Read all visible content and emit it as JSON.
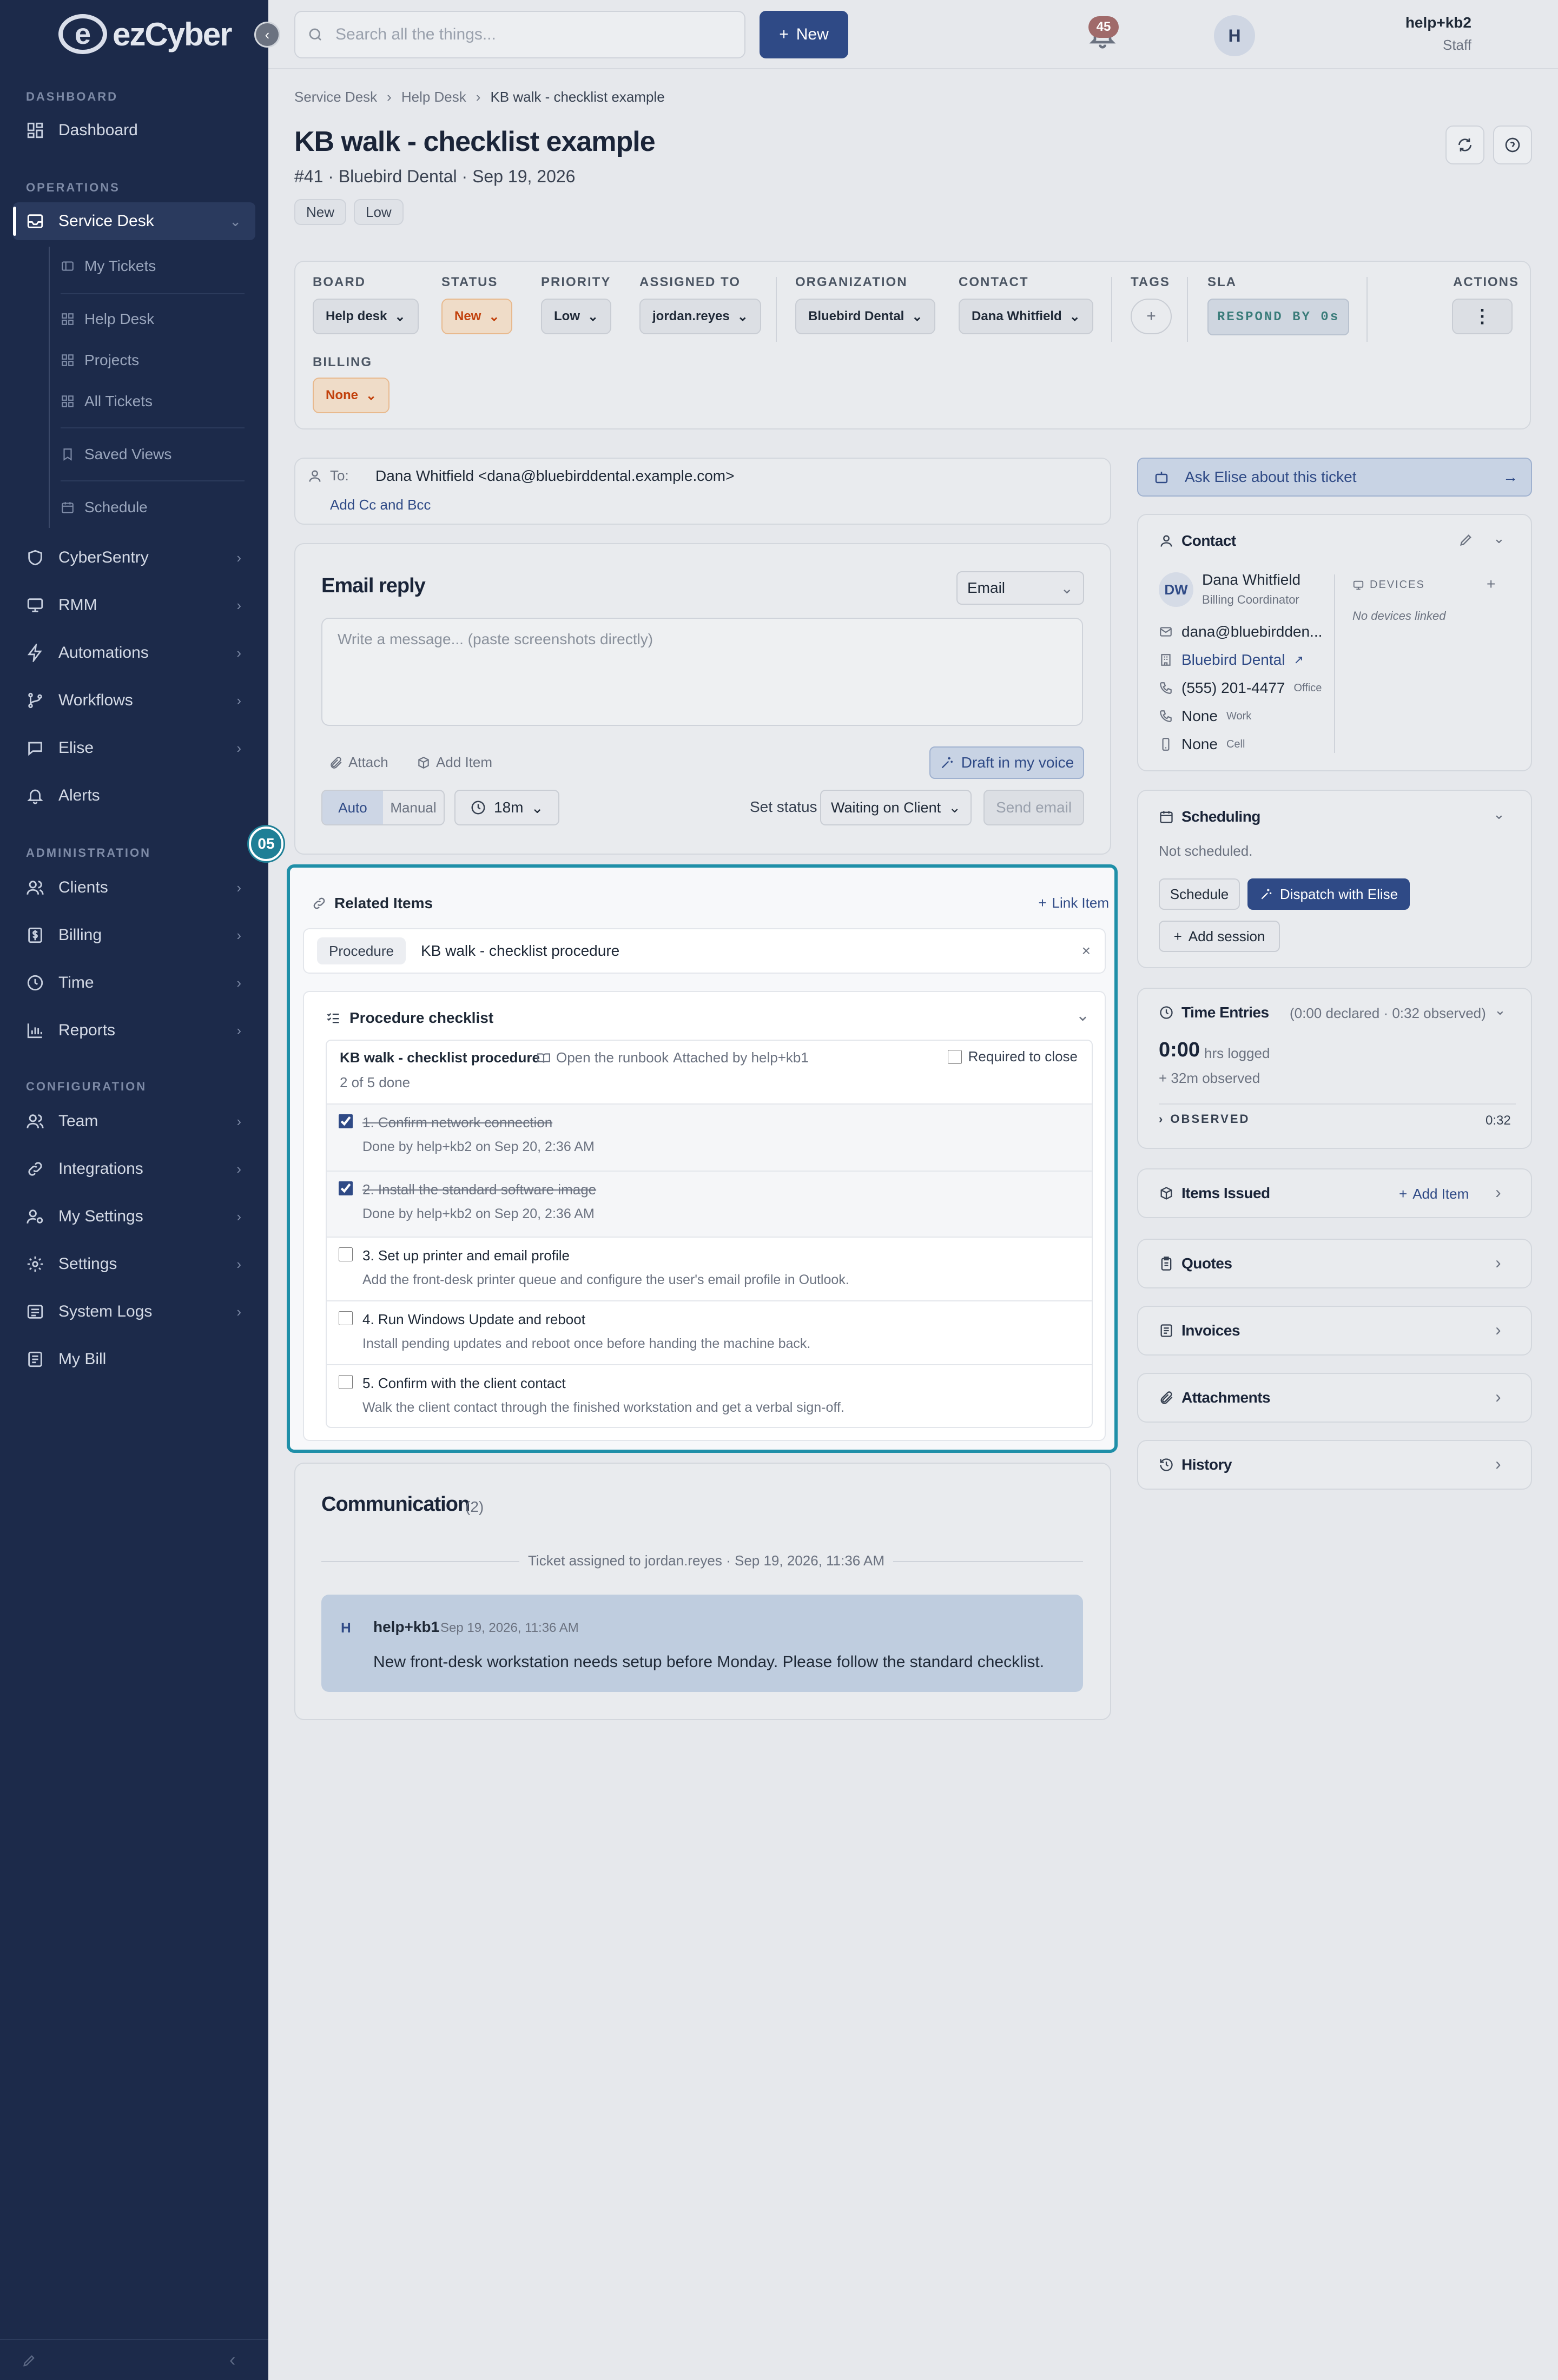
{
  "brand": {
    "logo_text": "ezCyber",
    "logo_letter": "e"
  },
  "sidebar": {
    "sections": [
      {
        "label": "DASHBOARD"
      },
      {
        "label": "OPERATIONS"
      },
      {
        "label": "ADMINISTRATION"
      },
      {
        "label": "CONFIGURATION"
      }
    ],
    "items": [
      {
        "label": "Dashboard"
      },
      {
        "label": "Service Desk"
      },
      {
        "label": "CyberSentry"
      },
      {
        "label": "RMM"
      },
      {
        "label": "Automations"
      },
      {
        "label": "Workflows"
      },
      {
        "label": "Elise"
      },
      {
        "label": "Alerts"
      },
      {
        "label": "Clients"
      },
      {
        "label": "Billing"
      },
      {
        "label": "Time"
      },
      {
        "label": "Reports"
      },
      {
        "label": "Team"
      },
      {
        "label": "Integrations"
      },
      {
        "label": "My Settings"
      },
      {
        "label": "Settings"
      },
      {
        "label": "System Logs"
      },
      {
        "label": "My Bill"
      }
    ],
    "sub_items": [
      {
        "label": "My Tickets"
      },
      {
        "label": "Help Desk"
      },
      {
        "label": "Projects"
      },
      {
        "label": "All Tickets"
      },
      {
        "label": "Saved Views"
      },
      {
        "label": "Schedule"
      }
    ]
  },
  "topbar": {
    "search_placeholder": "Search all the things...",
    "new_label": "New",
    "notification_count": "45",
    "user_name": "help+kb2",
    "user_role": "Staff",
    "avatar_letter": "H"
  },
  "breadcrumb": [
    "Service Desk",
    "Help Desk",
    "KB walk - checklist example"
  ],
  "ticket": {
    "title": "KB walk - checklist example",
    "subline": "#41 · Bluebird Dental · Sep 19, 2026",
    "chips": [
      "New",
      "Low"
    ]
  },
  "fields": {
    "board": {
      "label": "BOARD",
      "value": "Help desk"
    },
    "status": {
      "label": "STATUS",
      "value": "New"
    },
    "priority": {
      "label": "PRIORITY",
      "value": "Low"
    },
    "assigned": {
      "label": "ASSIGNED TO",
      "value": "jordan.reyes"
    },
    "organization": {
      "label": "ORGANIZATION",
      "value": "Bluebird Dental"
    },
    "contact": {
      "label": "CONTACT",
      "value": "Dana Whitfield"
    },
    "tags": {
      "label": "TAGS"
    },
    "sla": {
      "label": "SLA",
      "value": "RESPOND BY 0s"
    },
    "actions": {
      "label": "ACTIONS"
    },
    "billing": {
      "label": "BILLING",
      "value": "None"
    }
  },
  "email": {
    "to_label": "To:",
    "to_value": "Dana Whitfield <dana@bluebirddental.example.com>",
    "add_cc": "Add Cc and Bcc",
    "title": "Email reply",
    "channel": "Email",
    "placeholder": "Write a message... (paste screenshots directly)",
    "attach": "Attach",
    "add_item": "Add Item",
    "draft_voice": "Draft in my voice",
    "mode_auto": "Auto",
    "mode_manual": "Manual",
    "timer": "18m",
    "set_status_label": "Set status",
    "set_status_value": "Waiting on Client",
    "send": "Send email"
  },
  "related": {
    "badge": "05",
    "title": "Related Items",
    "link_item": "Link Item",
    "procedure_chip": "Procedure",
    "procedure_name": "KB walk - checklist procedure",
    "checklist_title": "Procedure checklist",
    "proc_header": "KB walk - checklist procedure",
    "runbook": "Open the runbook",
    "attached_by": "Attached by help+kb1",
    "required_label": "Required to close",
    "progress": "2 of 5 done",
    "steps": [
      {
        "title": "1. Confirm network connection",
        "desc": "Done by help+kb2 on Sep 20, 2:36 AM",
        "done": true
      },
      {
        "title": "2. Install the standard software image",
        "desc": "Done by help+kb2 on Sep 20, 2:36 AM",
        "done": true
      },
      {
        "title": "3. Set up printer and email profile",
        "desc": "Add the front-desk printer queue and configure the user's email profile in Outlook.",
        "done": false
      },
      {
        "title": "4. Run Windows Update and reboot",
        "desc": "Install pending updates and reboot once before handing the machine back.",
        "done": false
      },
      {
        "title": "5. Confirm with the client contact",
        "desc": "Walk the client contact through the finished workstation and get a verbal sign-off.",
        "done": false
      }
    ]
  },
  "communication": {
    "title": "Communication",
    "count": "(2)",
    "system_event": "Ticket assigned to jordan.reyes · Sep 19, 2026, 11:36 AM",
    "note": {
      "avatar": "H",
      "author": "help+kb1",
      "time": "Sep 19, 2026, 11:36 AM",
      "body": "New front-desk workstation needs setup before Monday. Please follow the standard checklist."
    }
  },
  "right": {
    "ask_elise": "Ask Elise about this ticket",
    "contact": {
      "title": "Contact",
      "initials": "DW",
      "name": "Dana Whitfield",
      "role": "Billing Coordinator",
      "email": "dana@bluebirdden...",
      "org": "Bluebird Dental",
      "phone_office": "(555) 201-4477",
      "phone_office_tag": "Office",
      "phone_work": "None",
      "phone_work_tag": "Work",
      "phone_cell": "None",
      "phone_cell_tag": "Cell",
      "devices_label": "DEVICES",
      "no_devices": "No devices linked"
    },
    "scheduling": {
      "title": "Scheduling",
      "status": "Not scheduled.",
      "schedule_btn": "Schedule",
      "dispatch_btn": "Dispatch with Elise",
      "add_session": "Add session"
    },
    "time_entries": {
      "title": "Time Entries",
      "summary": "(0:00 declared · 0:32 observed)",
      "logged": "0:00",
      "logged_label": "hrs logged",
      "observed_note": "+ 32m observed",
      "observed_label": "OBSERVED",
      "observed_value": "0:32"
    },
    "items_issued": {
      "title": "Items Issued",
      "add": "Add Item"
    },
    "quotes": "Quotes",
    "invoices": "Invoices",
    "attachments": "Attachments",
    "history": "History"
  }
}
